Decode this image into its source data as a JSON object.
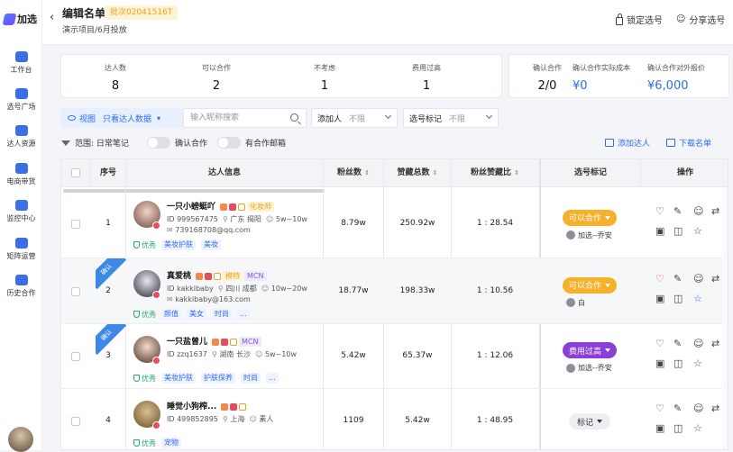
{
  "app": {
    "name": "加选"
  },
  "sidebar": {
    "items": [
      {
        "label": "工作台",
        "icon": "workbench-icon"
      },
      {
        "label": "选号广场",
        "icon": "square-icon"
      },
      {
        "label": "达人资源",
        "icon": "resource-icon"
      },
      {
        "label": "电商带货",
        "icon": "ecommerce-icon"
      },
      {
        "label": "监控中心",
        "icon": "monitor-icon"
      },
      {
        "label": "矩阵运营",
        "icon": "matrix-icon"
      },
      {
        "label": "历史合作",
        "icon": "history-icon"
      }
    ]
  },
  "header": {
    "title": "编辑名单",
    "batch": "批次02041516T",
    "subtitle": "演示项目/6月投放",
    "lock_label": "锁定选号",
    "share_label": "分享选号"
  },
  "stats": {
    "left": [
      {
        "label": "达人数",
        "value": "8"
      },
      {
        "label": "可以合作",
        "value": "2"
      },
      {
        "label": "不考虑",
        "value": "1"
      },
      {
        "label": "费用过高",
        "value": "1"
      }
    ],
    "right": [
      {
        "label": "确认合作",
        "value": "2/0"
      },
      {
        "label": "确认合作实际成本",
        "value": "¥0"
      },
      {
        "label": "确认合作对外报价",
        "value": "¥6,000"
      }
    ]
  },
  "filters": {
    "view_label": "视图",
    "view_value": "只看达人数据",
    "search_placeholder": "输入昵称搜索",
    "adder_label": "添加人",
    "adder_value": "不限",
    "mark_label": "选号标记",
    "mark_value": "不限",
    "range_label": "范围: 日常笔记",
    "confirm_label": "确认合作",
    "email_label": "有合作邮箱",
    "add_talent": "添加达人",
    "download": "下载名单"
  },
  "table": {
    "headers": [
      "序号",
      "达人信息",
      "粉丝数",
      "赞藏总数",
      "粉丝赞藏比",
      "选号标记",
      "操作"
    ],
    "rows": [
      {
        "index": "1",
        "name": "一只小螃蜓吖",
        "role": "化妆师",
        "role_color": "#f0a020",
        "role_bg": "#fff3d6",
        "mcn": "",
        "id": "ID 999567475",
        "loc": "广东 揭阳",
        "fans_range": "5w~10w",
        "email": "739168708@qq.com",
        "good": "优秀",
        "tags": [
          "美妆护肤",
          "美妆"
        ],
        "fans": "8.79w",
        "likes": "250.92w",
        "ratio": "1 : 28.54",
        "mark": "可以合作",
        "mark_color": "#f5b12a",
        "who": "加选--乔安",
        "confirmed": ""
      },
      {
        "index": "2",
        "name": "真爱桃",
        "role": "模特",
        "role_color": "#f0a020",
        "role_bg": "#fff3d6",
        "mcn": "MCN",
        "id": "ID kakkibaby",
        "loc": "四川 成都",
        "fans_range": "10w~20w",
        "email": "kakkibaby@163.com",
        "good": "优秀",
        "tags": [
          "颜值",
          "美女",
          "时尚",
          "..."
        ],
        "fans": "18.77w",
        "likes": "198.33w",
        "ratio": "1 : 10.56",
        "mark": "可以合作",
        "mark_color": "#f5b12a",
        "who": "白",
        "confirmed": "确认"
      },
      {
        "index": "3",
        "name": "一只盐曾儿",
        "role": "",
        "role_color": "",
        "role_bg": "",
        "mcn": "MCN",
        "id": "ID zzq1637",
        "loc": "湖南 长沙",
        "fans_range": "5w~10w",
        "email": "",
        "good": "优秀",
        "tags": [
          "美妆护肤",
          "护肤保养",
          "时尚",
          "..."
        ],
        "fans": "5.42w",
        "likes": "65.37w",
        "ratio": "1 : 12.06",
        "mark": "费用过高",
        "mark_color": "#8b3fd9",
        "who": "加选--乔安",
        "confirmed": "确认"
      },
      {
        "index": "4",
        "name": "睡觉小狗榨...",
        "role": "",
        "role_color": "",
        "role_bg": "",
        "mcn": "",
        "id": "ID 499852895",
        "loc": "上海",
        "fans_range": "素人",
        "email": "",
        "good": "优秀",
        "tags": [
          "宠物"
        ],
        "fans": "1109",
        "likes": "5.42w",
        "ratio": "1 : 48.95",
        "mark": "标记",
        "mark_color": "",
        "who": "",
        "confirmed": ""
      }
    ]
  },
  "colors": {
    "accent": "#2f6bf0",
    "ribbon": "#3d87e6"
  }
}
